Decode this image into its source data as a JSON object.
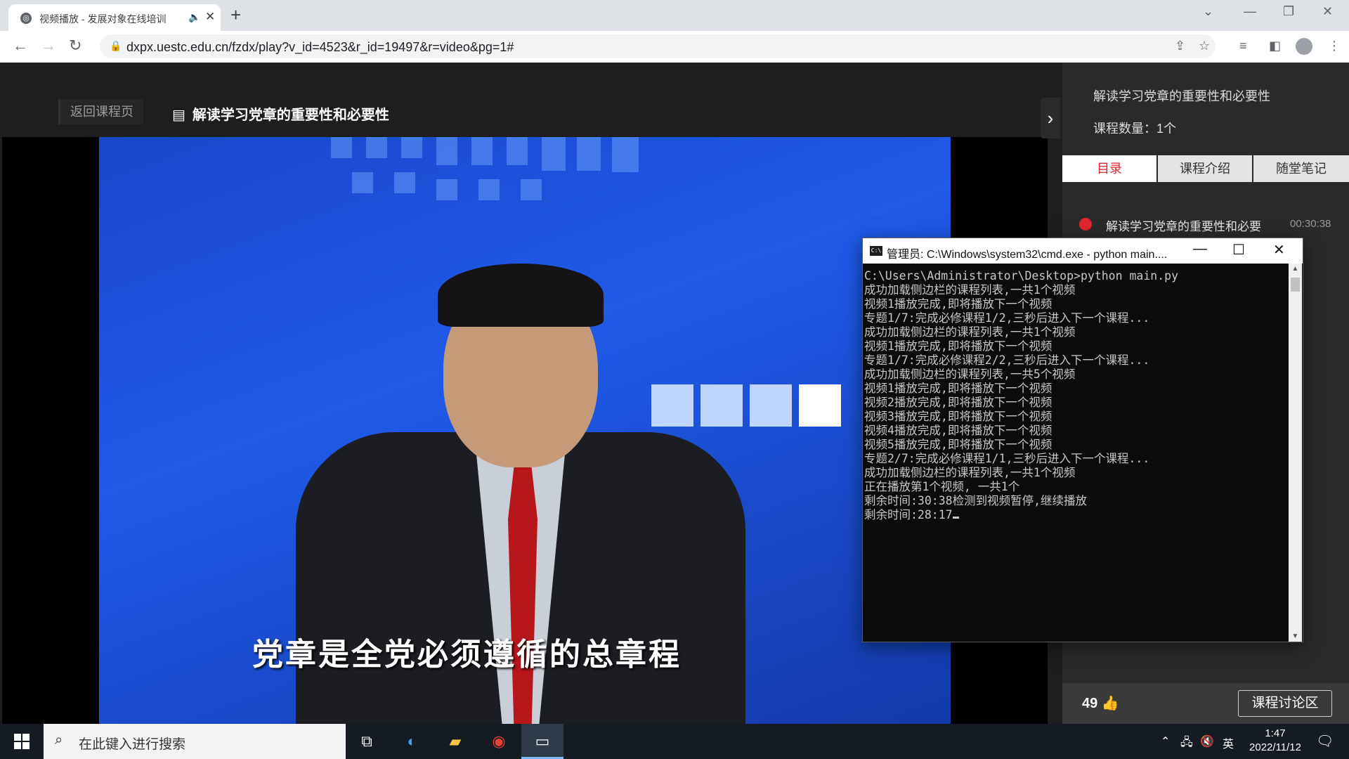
{
  "browser": {
    "tab_title": "视频播放 - 发展对象在线培训",
    "url": "dxpx.uestc.edu.cn/fzdx/play?v_id=4523&r_id=19497&r=video&pg=1#"
  },
  "header": {
    "back_label": "返回课程页",
    "course_title": "解读学习党章的重要性和必要性"
  },
  "video": {
    "subtitle": "党章是全党必须遵循的总章程"
  },
  "sidebar": {
    "title": "解读学习党章的重要性和必要性",
    "count": "课程数量：1个",
    "tabs": [
      "目录",
      "课程介绍",
      "随堂笔记"
    ],
    "items": [
      {
        "label": "解读学习党章的重要性和必要",
        "duration": "00:30:38"
      }
    ],
    "likes": "49",
    "discuss_label": "课程讨论区"
  },
  "cmd": {
    "title": "管理员: C:\\Windows\\system32\\cmd.exe - python  main....",
    "lines": [
      "C:\\Users\\Administrator\\Desktop>python main.py",
      "成功加载侧边栏的课程列表,一共1个视频",
      "视频1播放完成,即将播放下一个视频",
      "专题1/7:完成必修课程1/2,三秒后进入下一个课程...",
      "成功加载侧边栏的课程列表,一共1个视频",
      "视频1播放完成,即将播放下一个视频",
      "专题1/7:完成必修课程2/2,三秒后进入下一个课程...",
      "成功加载侧边栏的课程列表,一共5个视频",
      "视频1播放完成,即将播放下一个视频",
      "视频2播放完成,即将播放下一个视频",
      "视频3播放完成,即将播放下一个视频",
      "视频4播放完成,即将播放下一个视频",
      "视频5播放完成,即将播放下一个视频",
      "专题2/7:完成必修课程1/1,三秒后进入下一个课程...",
      "成功加载侧边栏的课程列表,一共1个视频",
      "正在播放第1个视频, 一共1个",
      "剩余时间:30:38检测到视频暂停,继续播放",
      "剩余时间:28:17"
    ]
  },
  "taskbar": {
    "search_placeholder": "在此键入进行搜索",
    "ime": "英",
    "time": "1:47",
    "date": "2022/11/12"
  },
  "colors": {
    "accent_red": "#e0262d",
    "video_blue": "#1f5ae8",
    "taskbar_bg": "#141b23"
  }
}
